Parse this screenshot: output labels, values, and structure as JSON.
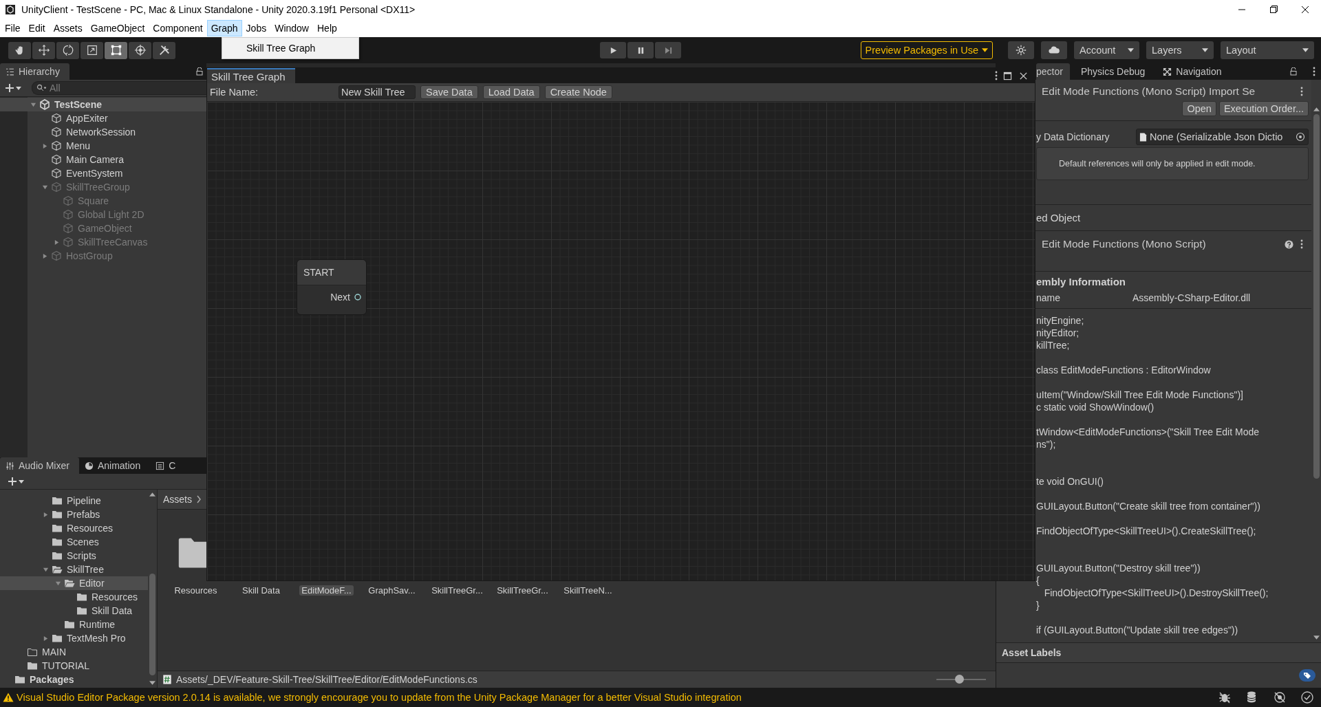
{
  "window": {
    "title": "UnityClient - TestScene - PC, Mac & Linux Standalone - Unity 2020.3.19f1 Personal <DX11>"
  },
  "menu_bar": [
    {
      "label": "File",
      "selected": false
    },
    {
      "label": "Edit",
      "selected": false
    },
    {
      "label": "Assets",
      "selected": false
    },
    {
      "label": "GameObject",
      "selected": false
    },
    {
      "label": "Component",
      "selected": false
    },
    {
      "label": "Graph",
      "selected": true
    },
    {
      "label": "Jobs",
      "selected": false
    },
    {
      "label": "Window",
      "selected": false
    },
    {
      "label": "Help",
      "selected": false
    }
  ],
  "open_menu": {
    "items": [
      "Skill Tree Graph"
    ]
  },
  "toolbar": {
    "tools": [
      {
        "kind": "hand",
        "selected": false
      },
      {
        "kind": "move",
        "selected": false
      },
      {
        "kind": "rotate",
        "selected": false
      },
      {
        "kind": "scale",
        "selected": false
      },
      {
        "kind": "rect",
        "selected": true
      },
      {
        "kind": "transform",
        "selected": false
      },
      {
        "kind": "custom",
        "selected": false
      }
    ],
    "preview_packages": "Preview Packages in Use",
    "account": "Account",
    "layers": "Layers",
    "layout": "Layout"
  },
  "hierarchy": {
    "tab": "Hierarchy",
    "search_placeholder": "All",
    "tree": [
      {
        "label": "TestScene",
        "kind": "scene",
        "active": true,
        "expanded": true,
        "children": [
          {
            "label": "AppExiter",
            "active": true
          },
          {
            "label": "NetworkSession",
            "active": true
          },
          {
            "label": "Menu",
            "active": true,
            "expanded": false
          },
          {
            "label": "Main Camera",
            "active": true
          },
          {
            "label": "EventSystem",
            "active": true
          },
          {
            "label": "SkillTreeGroup",
            "active": false,
            "expanded": true,
            "children": [
              {
                "label": "Square",
                "active": false
              },
              {
                "label": "Global Light 2D",
                "active": false
              },
              {
                "label": "GameObject",
                "active": false
              },
              {
                "label": "SkillTreeCanvas",
                "active": false,
                "expanded": false
              }
            ]
          },
          {
            "label": "HostGroup",
            "active": false,
            "expanded": false
          }
        ]
      }
    ]
  },
  "bottom_tabs": [
    {
      "label": "Audio Mixer",
      "kind": "mixer",
      "selected": true
    },
    {
      "label": "Animation",
      "kind": "clock",
      "selected": false
    },
    {
      "label": "C",
      "kind": "console",
      "selected": false
    }
  ],
  "project": {
    "tree": [
      {
        "children": [
          {
            "children": [
              {
                "children": [
                  {
                    "label": "Pipeline",
                    "kind": "folder",
                    "selected": false
                  },
                  {
                    "label": "Prefabs",
                    "kind": "folder",
                    "selected": false,
                    "expanded": false
                  },
                  {
                    "label": "Resources",
                    "kind": "folder",
                    "selected": false
                  },
                  {
                    "label": "Scenes",
                    "kind": "folder",
                    "selected": false
                  },
                  {
                    "label": "Scripts",
                    "kind": "folder",
                    "selected": false
                  },
                  {
                    "label": "SkillTree",
                    "kind": "folder",
                    "selected": false,
                    "expanded": true,
                    "children": [
                      {
                        "label": "Editor",
                        "kind": "folder",
                        "selected": true,
                        "expanded": true,
                        "children": [
                          {
                            "label": "Resources",
                            "kind": "folder",
                            "selected": false
                          },
                          {
                            "label": "Skill Data",
                            "kind": "folder",
                            "selected": false
                          }
                        ]
                      },
                      {
                        "label": "Runtime",
                        "kind": "folder",
                        "selected": false
                      }
                    ]
                  },
                  {
                    "label": "TextMesh Pro",
                    "kind": "folder",
                    "selected": false,
                    "expanded": false
                  }
                ]
              }
            ]
          },
          {
            "label": "MAIN",
            "kind": "empty-folder",
            "selected": false
          },
          {
            "label": "TUTORIAL",
            "kind": "folder",
            "selected": false
          }
        ]
      },
      {
        "label": "Packages",
        "kind": "root",
        "selected": false
      }
    ],
    "breadcrumb": "Assets",
    "assets": [
      {
        "label": "Resources",
        "kind": "folder",
        "selected": false
      },
      {
        "label": "Skill Data",
        "selected": false
      },
      {
        "label": "EditModeF...",
        "selected": true
      },
      {
        "label": "GraphSav...",
        "selected": false
      },
      {
        "label": "SkillTreeGr...",
        "selected": false
      },
      {
        "label": "SkillTreeGr...",
        "selected": false
      },
      {
        "label": "SkillTreeN...",
        "selected": false
      }
    ],
    "path": "Assets/_DEV/Feature-Skill-Tree/SkillTree/Editor/EditModeFunctions.cs",
    "zoom_slider": {
      "level": 0.45
    }
  },
  "inspector": {
    "tabs": [
      {
        "label": "pector",
        "selected": true
      },
      {
        "label": "Physics Debug",
        "selected": false
      },
      {
        "label": "Navigation",
        "kind": "navigation",
        "selected": false
      }
    ],
    "header": "Edit Mode Functions (Mono Script) Import Se",
    "buttons": [
      "Open",
      "Execution Order..."
    ],
    "field": {
      "label": "y Data Dictionary",
      "value": "None (Serializable Json Dictio"
    },
    "help": "Default references will only be applied in edit mode.",
    "section": "ed Object",
    "script_header": "Edit Mode Functions (Mono Script)",
    "assembly": {
      "title": "embly Information",
      "name_label": "name",
      "name_value": "Assembly-CSharp-Editor.dll"
    },
    "code": [
      {
        "blocks": [
          {
            "lines": [
              "nityEngine;",
              "nityEditor;",
              "killTree;"
            ]
          },
          {
            "lines": [
              "class EditModeFunctions : EditorWindow"
            ]
          },
          {
            "lines": [
              "uItem(\"Window/Skill Tree Edit Mode Functions\")]",
              "c static void ShowWindow()"
            ]
          },
          {
            "lines": [
              "tWindow<EditModeFunctions>(\"Skill Tree Edit Mode",
              "ns\");"
            ]
          }
        ]
      },
      {
        "blocks": [
          {
            "lines": [
              "te void OnGUI()"
            ]
          },
          {
            "lines": [
              "GUILayout.Button(\"Create skill tree from container\"))"
            ]
          },
          {
            "lines": [
              "FindObjectOfType<SkillTreeUI>().CreateSkillTree();"
            ]
          }
        ]
      },
      {
        "blocks": [
          {
            "lines": [
              "GUILayout.Button(\"Destroy skill tree\"))",
              "{",
              "   FindObjectOfType<SkillTreeUI>().DestroySkillTree();",
              "}"
            ]
          },
          {
            "lines": [
              "if (GUILayout.Button(\"Update skill tree edges\"))"
            ]
          }
        ]
      }
    ],
    "asset_labels": "Asset Labels"
  },
  "graph_window": {
    "title": "Skill Tree Graph",
    "file_name_label": "File Name:",
    "file_name": "New Skill Tree",
    "buttons": [
      "Save Data",
      "Load Data",
      "Create Node"
    ],
    "nodes": [
      {
        "title": "START",
        "ports": [
          "Next"
        ]
      }
    ]
  },
  "status_bar": {
    "message": "Visual Studio Editor Package version 2.0.14 is available, we strongly encourage you to update from the Unity Package Manager for a better Visual Studio integration"
  }
}
